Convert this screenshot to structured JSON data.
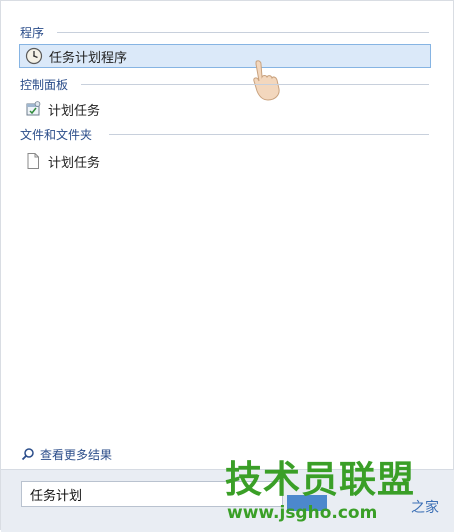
{
  "groups": [
    {
      "header": "程序",
      "items": [
        {
          "label": "任务计划程序",
          "icon": "task-scheduler-clock-icon",
          "selected": true
        }
      ]
    },
    {
      "header": "控制面板",
      "items": [
        {
          "label": "计划任务",
          "icon": "control-panel-scheduled-tasks-icon",
          "selected": false
        }
      ]
    },
    {
      "header": "文件和文件夹",
      "items": [
        {
          "label": "计划任务",
          "icon": "document-file-icon",
          "selected": false
        }
      ]
    }
  ],
  "more_results": {
    "label": "查看更多结果",
    "icon": "search-icon"
  },
  "search": {
    "value": "任务计划"
  },
  "watermark": {
    "logo_text": "技术员联盟",
    "url_text": "www.jsgho.com",
    "partial_text": "之家"
  },
  "colors": {
    "header_text": "#2b4d8a",
    "selected_bg": "#dbe9f9",
    "selected_border": "#86b4e3",
    "watermark_green": "#3a9f27"
  }
}
